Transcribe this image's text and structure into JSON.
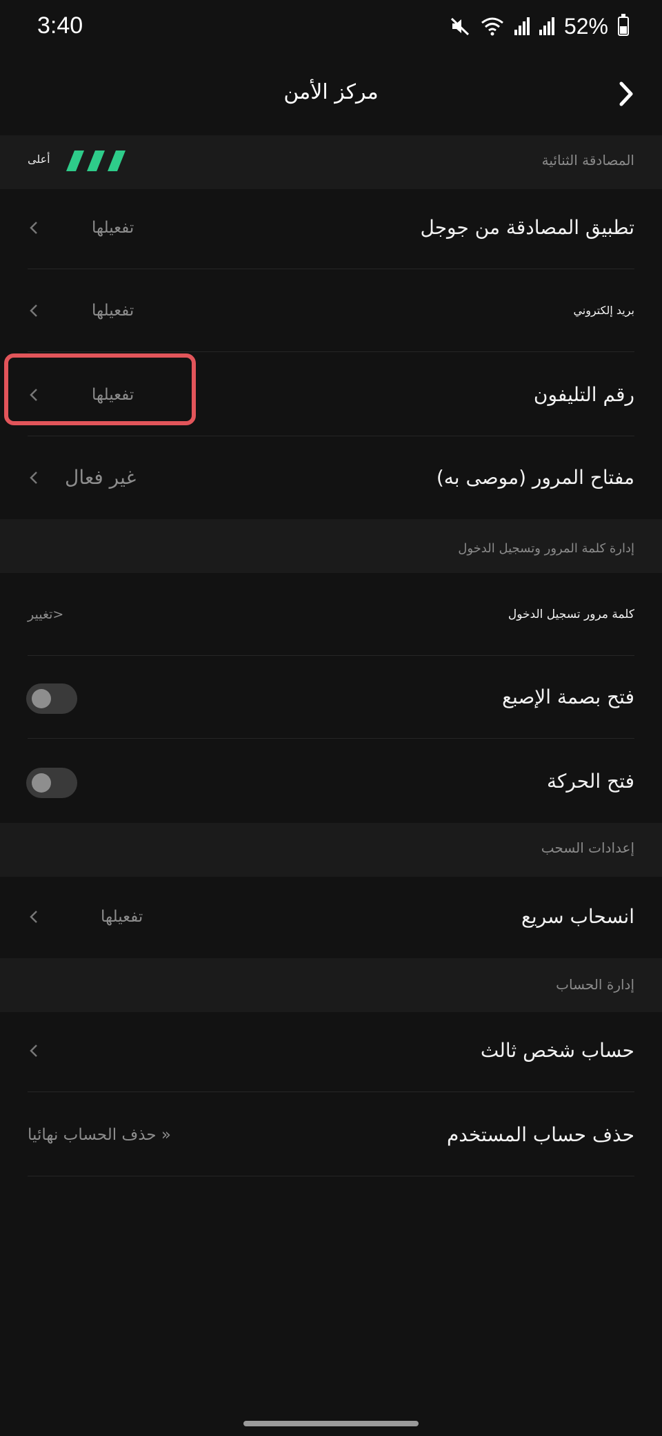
{
  "status_bar": {
    "time": "3:40",
    "battery": "52%",
    "battery_level": 0.52
  },
  "header": {
    "title": "مركز الأمن"
  },
  "two_factor": {
    "section_title": "المصادقة الثنائية",
    "strength_label": "أعلى",
    "strength_color": "#2ecc8a",
    "items": [
      {
        "label": "تطبيق المصادقة من جوجل",
        "value": "تفعيلها"
      },
      {
        "label": "بريد إلكتروني",
        "value": "تفعيلها"
      },
      {
        "label": "رقم التليفون",
        "value": "تفعيلها"
      },
      {
        "label": "مفتاح المرور (موصى به)",
        "value": "غير فعال"
      }
    ]
  },
  "password_section": {
    "section_title": "إدارة كلمة المرور وتسجيل الدخول",
    "login_password": {
      "label": "كلمة مرور تسجيل الدخول",
      "value": "تغيير>"
    },
    "fingerprint": {
      "label": "فتح بصمة الإصبع",
      "enabled": false
    },
    "gesture": {
      "label": "فتح الحركة",
      "enabled": false
    }
  },
  "withdraw_section": {
    "section_title": "إعدادات السحب",
    "quick_withdraw": {
      "label": "انسحاب سريع",
      "value": "تفعيلها"
    }
  },
  "account_section": {
    "section_title": "إدارة الحساب",
    "third_party": {
      "label": "حساب شخص ثالث"
    },
    "delete_account": {
      "label": "حذف حساب المستخدم",
      "value": "حذف الحساب نهائيا »"
    }
  },
  "colors": {
    "highlight": "#e2555a",
    "background": "#121212"
  }
}
